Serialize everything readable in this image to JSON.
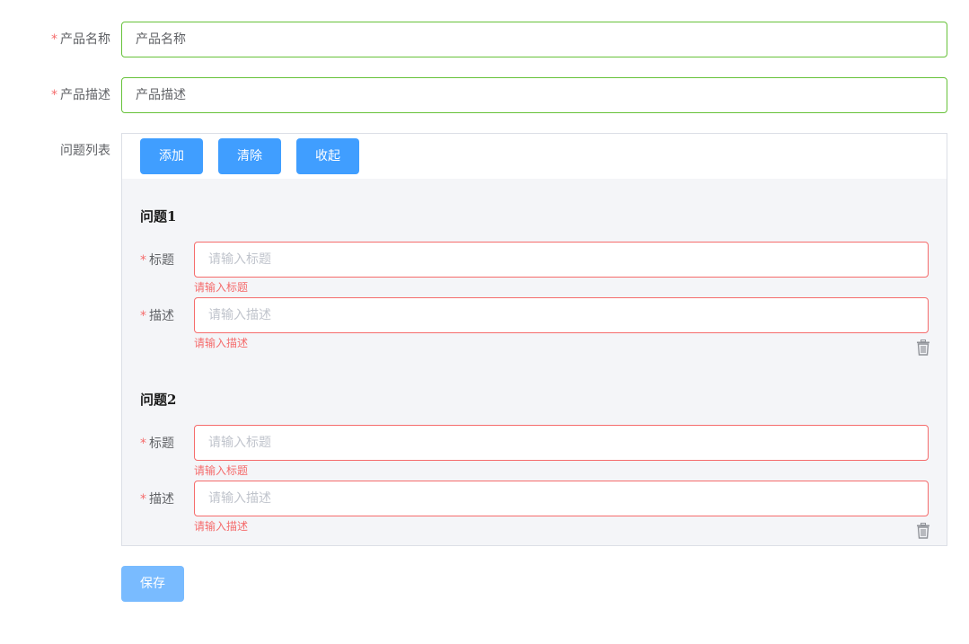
{
  "form": {
    "product_name": {
      "label": "产品名称",
      "value": "产品名称"
    },
    "product_desc": {
      "label": "产品描述",
      "value": "产品描述"
    },
    "question_list_label": "问题列表",
    "required_mark": "*"
  },
  "toolbar": {
    "add_label": "添加",
    "clear_label": "清除",
    "collapse_label": "收起"
  },
  "questions": [
    {
      "title": "问题1",
      "title_field": {
        "label": "标题",
        "placeholder": "请输入标题",
        "error": "请输入标题"
      },
      "desc_field": {
        "label": "描述",
        "placeholder": "请输入描述",
        "error": "请输入描述"
      },
      "delete_icon": "trash-icon"
    },
    {
      "title": "问题2",
      "title_field": {
        "label": "标题",
        "placeholder": "请输入标题",
        "error": "请输入标题"
      },
      "desc_field": {
        "label": "描述",
        "placeholder": "请输入描述",
        "error": "请输入描述"
      },
      "delete_icon": "trash-icon"
    }
  ],
  "save_label": "保存",
  "colors": {
    "primary": "#409eff",
    "primary_disabled": "#79bbff",
    "success": "#67c23a",
    "danger": "#f56c6c"
  }
}
